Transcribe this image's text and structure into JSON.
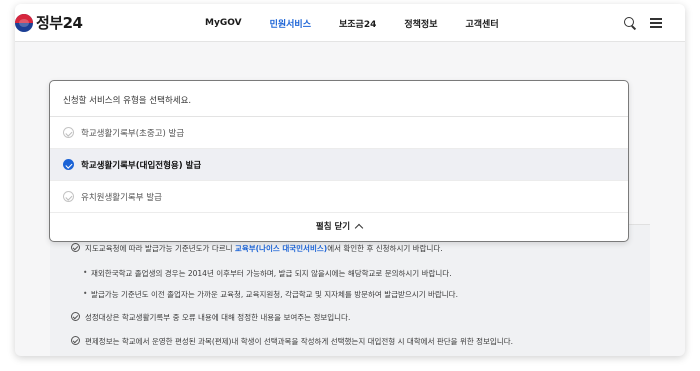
{
  "header": {
    "logo_text": "정부24",
    "nav": [
      "MyGOV",
      "민원서비스",
      "보조금24",
      "정책정보",
      "고객센터"
    ],
    "active_nav_index": 1,
    "icons": [
      "search-icon",
      "menu-icon"
    ]
  },
  "dropdown": {
    "prompt": "신청할 서비스의 유형을 선택하세요.",
    "options": [
      {
        "label": "학교생활기록부(초중고) 발급",
        "selected": false
      },
      {
        "label": "학교생활기록부(대입전형용) 발급",
        "selected": true
      },
      {
        "label": "유치원생활기록부 발급",
        "selected": false
      }
    ],
    "close_label": "펼침 닫기"
  },
  "background": {
    "line1_pre": "지도교육청에 따라 발급가능 기준년도가 다르니 ",
    "line1_link": "교육부(나이스 대국민서비스)",
    "line1_post": "에서 확인한 후 신청하시기 바랍니다.",
    "bullet1": "재외한국학교 졸업생의 경우는 2014년 이후부터 가능하며, 발급 되지 않을시에는 해당학교로 문의하시기 바랍니다.",
    "bullet2": "발급가능 기준년도 이전 졸업자는 가까운 교육청, 교육지원청, 각급학교 및 지자체를 방문하여 발급받으시기 바랍니다.",
    "line2": "성정대상은 학교생활기록부 중 오류 내용에 대해 정정한 내용을 보여주는 정보입니다.",
    "line3": "편제정보는 학교에서 운영한 편성된 과목(편제)내 학생이 선택과목을 작성하게 선택했는지 대입전형 시 대학에서 판단을 위한 정보입니다."
  },
  "colors": {
    "accent": "#1b63d6",
    "selected_bg": "#eeeff3"
  }
}
